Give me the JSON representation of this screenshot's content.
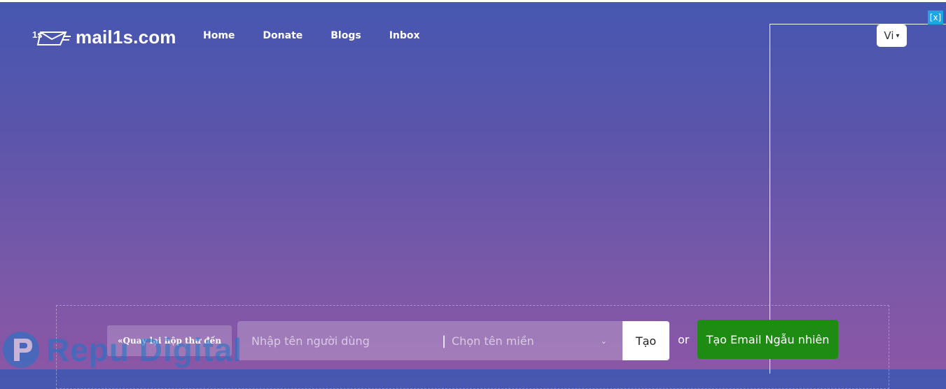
{
  "header": {
    "site_name": "mail1s.com",
    "logo_mark": "1s",
    "nav": [
      "Home",
      "Donate",
      "Blogs",
      "Inbox"
    ],
    "language": "Vi"
  },
  "ad": {
    "close_label": "[x]"
  },
  "form": {
    "back_label": "«Quay lại hộp thư đến",
    "username_placeholder": "Nhập tên người dùng",
    "separator": "|",
    "domain_placeholder": "Chọn tên miền",
    "create_label": "Tạo",
    "or_label": "or",
    "random_label": "Tạo Email Ngẫu nhiên"
  },
  "watermark": {
    "text": "Repu Digital",
    "color": "#1877c9"
  },
  "colors": {
    "gradient_top": "#4657b1",
    "gradient_bottom": "#8b56a6",
    "random_button": "#1e8c12",
    "ad_close": "#1da6e2"
  }
}
